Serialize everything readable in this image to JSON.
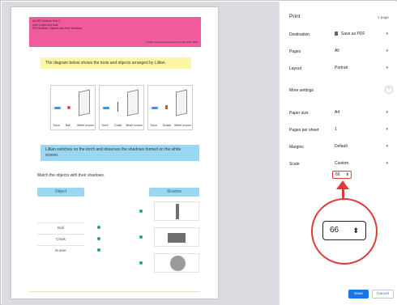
{
  "dialog": {
    "title": "Print",
    "page_count": "1 page",
    "save_label": "Save",
    "cancel_label": "Cancel"
  },
  "settings": {
    "destination": {
      "label": "Destination",
      "value": "Save as PDF"
    },
    "pages": {
      "label": "Pages",
      "value": "All"
    },
    "layout": {
      "label": "Layout",
      "value": "Portrait"
    },
    "more_settings": "More settings",
    "paper_size": {
      "label": "Paper size",
      "value": "A4"
    },
    "pages_per_sheet": {
      "label": "Pages per sheet",
      "value": "1"
    },
    "margins": {
      "label": "Margins",
      "value": "Default"
    },
    "scale": {
      "label": "Scale",
      "value": "Custom",
      "custom_value": "66"
    }
  },
  "icons": {
    "chevron": "▾",
    "spinner": "⬍",
    "collapse": "⌃"
  },
  "colors": {
    "accent": "#1a73e8",
    "highlight": "#e03b3b",
    "header_pink": "#ef5b9c"
  },
  "preview": {
    "header_lines": [
      "ALLER Science Year 3",
      "Unit 4 Light and Dark",
      "P03 Shadow: Objects and their shadows"
    ],
    "copyright": "© Aller Learning & Assessment Service 2021, 2022",
    "intro": "The diagram below shows the tools and objects arranged by Lillian.",
    "scenes": [
      [
        "Torch",
        "Ball",
        "White screen"
      ],
      [
        "Torch",
        "Chalk",
        "White screen"
      ],
      [
        "Torch",
        "Eraser",
        "White screen"
      ]
    ],
    "note": "Lillian switches on the torch and observes the shadows formed on the white screen.",
    "instruction": "Match the objects with their shadows.",
    "col_object": "Object",
    "col_shadow": "Shadow",
    "objects": [
      "Ball",
      "Chalk",
      "Eraser"
    ]
  }
}
